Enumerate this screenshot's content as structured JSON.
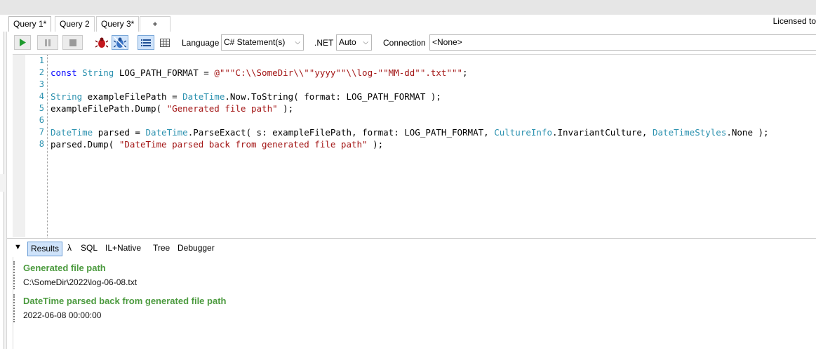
{
  "tabs": [
    {
      "label": "Query 1*",
      "active": true
    },
    {
      "label": "Query 2",
      "active": false
    },
    {
      "label": "Query 3*",
      "active": false
    },
    {
      "label": "+",
      "active": false
    }
  ],
  "licensed_text": "Licensed to",
  "toolbar": {
    "language_label": "Language",
    "language_value": "C# Statement(s)",
    "dotnet_label": ".NET",
    "dotnet_value": "Auto",
    "connection_label": "Connection",
    "connection_value": "<None>"
  },
  "editor": {
    "line_numbers": [
      "1",
      "2",
      "3",
      "4",
      "5",
      "6",
      "7",
      "8"
    ],
    "line2": {
      "a": "const",
      "b": " ",
      "c": "String",
      "d": " LOG_PATH_FORMAT = ",
      "e": "@\"\"\"C:\\\\SomeDir\\\\\"\"yyyy\"\"\\\\log-\"\"MM-dd\"\".txt\"\"\"",
      "f": ";"
    },
    "line4": {
      "a": "String",
      "b": " exampleFilePath = ",
      "c": "DateTime",
      "d": ".Now.ToString( format: LOG_PATH_FORMAT );"
    },
    "line5": {
      "a": "exampleFilePath.Dump( ",
      "b": "\"Generated file path\"",
      "c": " );"
    },
    "line7": {
      "a": "DateTime",
      "b": " parsed = ",
      "c": "DateTime",
      "d": ".ParseExact( s: exampleFilePath, format: LOG_PATH_FORMAT, ",
      "e": "CultureInfo",
      "f": ".InvariantCulture, ",
      "g": "DateTimeStyles",
      "h": ".None );"
    },
    "line8": {
      "a": "parsed.Dump( ",
      "b": "\"DateTime parsed back from generated file path\"",
      "c": " );"
    }
  },
  "result_tabs": [
    "Results",
    "λ",
    "SQL",
    "IL+Native",
    "Tree",
    "Debugger"
  ],
  "results": [
    {
      "heading": "Generated file path",
      "value": "C:\\SomeDir\\2022\\log-06-08.txt"
    },
    {
      "heading": "DateTime parsed back from generated file path",
      "value": "2022-06-08 00:00:00"
    }
  ],
  "colors": {
    "keyword": "#0000ff",
    "type": "#2b91af",
    "string": "#a31515",
    "result_heading": "#4b9a3e"
  }
}
